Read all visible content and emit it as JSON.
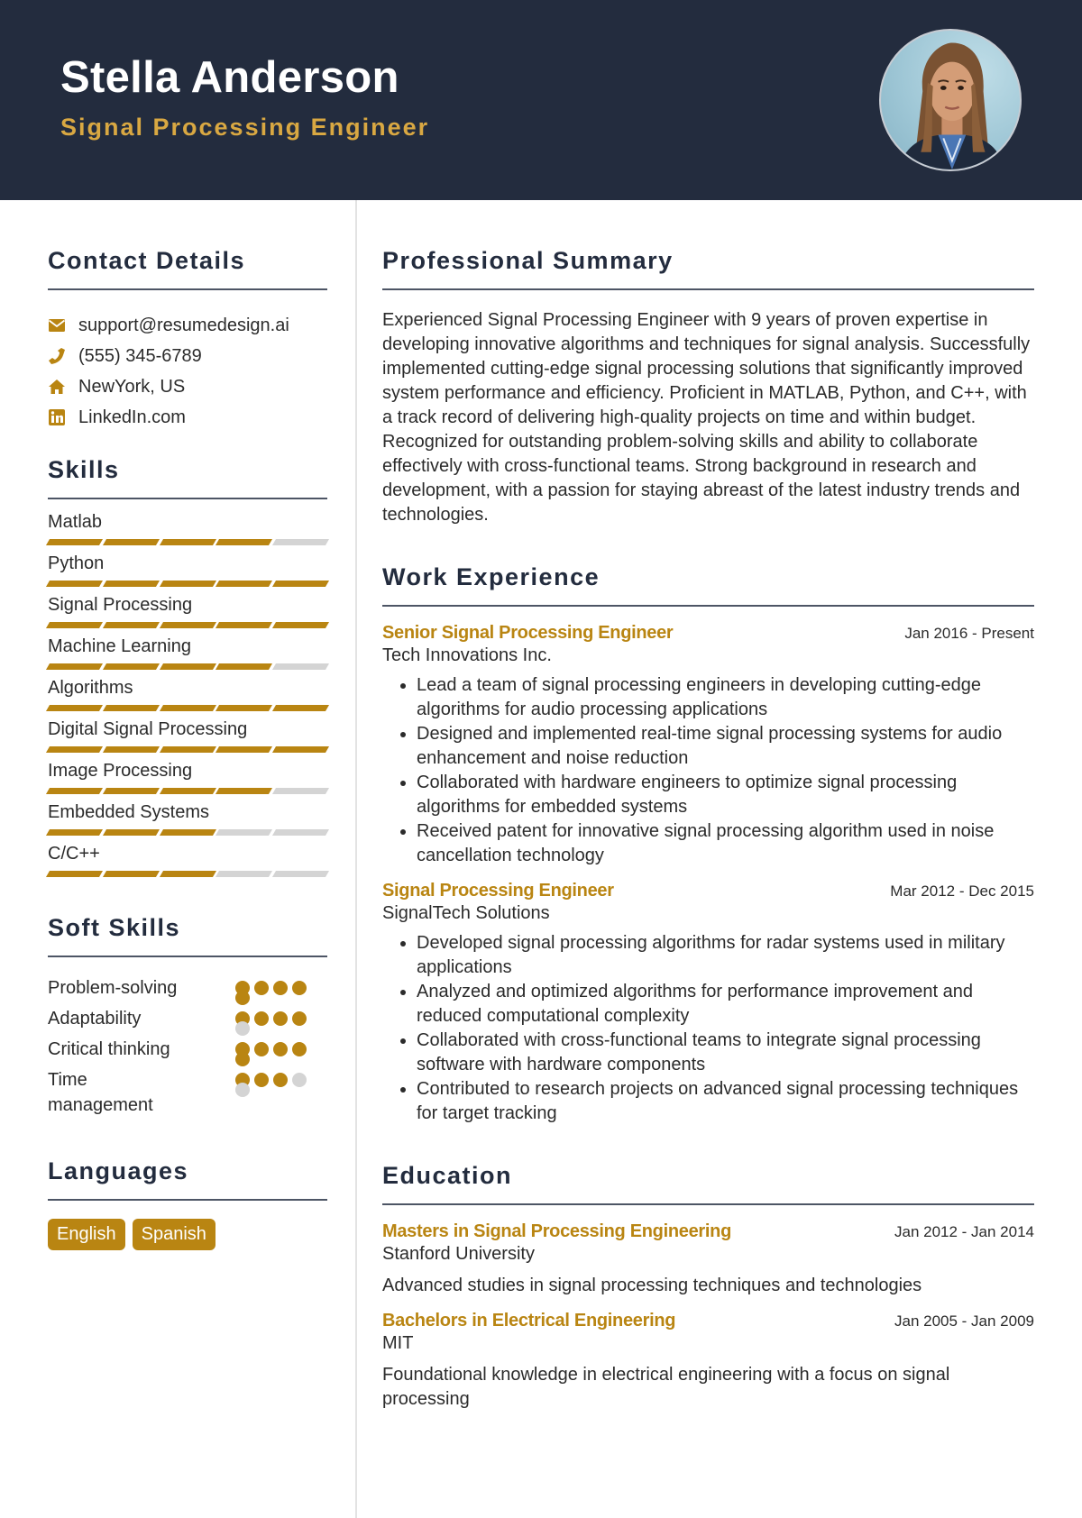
{
  "header": {
    "name": "Stella Anderson",
    "title": "Signal Processing Engineer",
    "photo": "profile-photo"
  },
  "colors": {
    "header_bg": "#232c3e",
    "accent": "#b98512",
    "title_gold": "#d9a842",
    "heading": "#232c3e",
    "inactive": "#d4d4d4"
  },
  "contact": {
    "title": "Contact Details",
    "items": [
      {
        "icon": "envelope-icon",
        "text": "support@resumedesign.ai"
      },
      {
        "icon": "phone-icon",
        "text": "(555) 345-6789"
      },
      {
        "icon": "home-icon",
        "text": "NewYork, US"
      },
      {
        "icon": "linkedin-icon",
        "text": "LinkedIn.com"
      }
    ]
  },
  "skills": {
    "title": "Skills",
    "max": 5,
    "items": [
      {
        "name": "Matlab",
        "level": 4
      },
      {
        "name": "Python",
        "level": 5
      },
      {
        "name": "Signal Processing",
        "level": 5
      },
      {
        "name": "Machine Learning",
        "level": 4
      },
      {
        "name": "Algorithms",
        "level": 5
      },
      {
        "name": "Digital Signal Processing",
        "level": 5
      },
      {
        "name": "Image Processing",
        "level": 4
      },
      {
        "name": "Embedded Systems",
        "level": 3
      },
      {
        "name": "C/C++",
        "level": 3
      }
    ]
  },
  "soft_skills": {
    "title": "Soft Skills",
    "max": 5,
    "items": [
      {
        "name": "Problem-solving",
        "level": 5
      },
      {
        "name": "Adaptability",
        "level": 4
      },
      {
        "name": "Critical thinking",
        "level": 5
      },
      {
        "name": "Time management",
        "level": 3
      }
    ]
  },
  "languages": {
    "title": "Languages",
    "items": [
      "English",
      "Spanish"
    ]
  },
  "summary": {
    "title": "Professional Summary",
    "text": "Experienced Signal Processing Engineer with 9 years of proven expertise in developing innovative algorithms and techniques for signal analysis. Successfully implemented cutting-edge signal processing solutions that significantly improved system performance and efficiency. Proficient in MATLAB, Python, and C++, with a track record of delivering high-quality projects on time and within budget. Recognized for outstanding problem-solving skills and ability to collaborate effectively with cross-functional teams. Strong background in research and development, with a passion for staying abreast of the latest industry trends and technologies."
  },
  "experience": {
    "title": "Work Experience",
    "jobs": [
      {
        "role": "Senior Signal Processing Engineer",
        "company": "Tech Innovations Inc.",
        "dates": "Jan 2016 - Present",
        "bullets": [
          "Lead a team of signal processing engineers in developing cutting-edge algorithms for audio processing applications",
          "Designed and implemented real-time signal processing systems for audio enhancement and noise reduction",
          "Collaborated with hardware engineers to optimize signal processing algorithms for embedded systems",
          "Received patent for innovative signal processing algorithm used in noise cancellation technology"
        ]
      },
      {
        "role": "Signal Processing Engineer",
        "company": "SignalTech Solutions",
        "dates": "Mar 2012 - Dec 2015",
        "bullets": [
          "Developed signal processing algorithms for radar systems used in military applications",
          "Analyzed and optimized algorithms for performance improvement and reduced computational complexity",
          "Collaborated with cross-functional teams to integrate signal processing software with hardware components",
          "Contributed to research projects on advanced signal processing techniques for target tracking"
        ]
      }
    ]
  },
  "education": {
    "title": "Education",
    "items": [
      {
        "degree": "Masters in Signal Processing Engineering",
        "school": "Stanford University",
        "dates": "Jan 2012 - Jan 2014",
        "description": "Advanced studies in signal processing techniques and technologies"
      },
      {
        "degree": "Bachelors in Electrical Engineering",
        "school": "MIT",
        "dates": "Jan 2005 - Jan 2009",
        "description": "Foundational knowledge in electrical engineering with a focus on signal processing"
      }
    ]
  }
}
